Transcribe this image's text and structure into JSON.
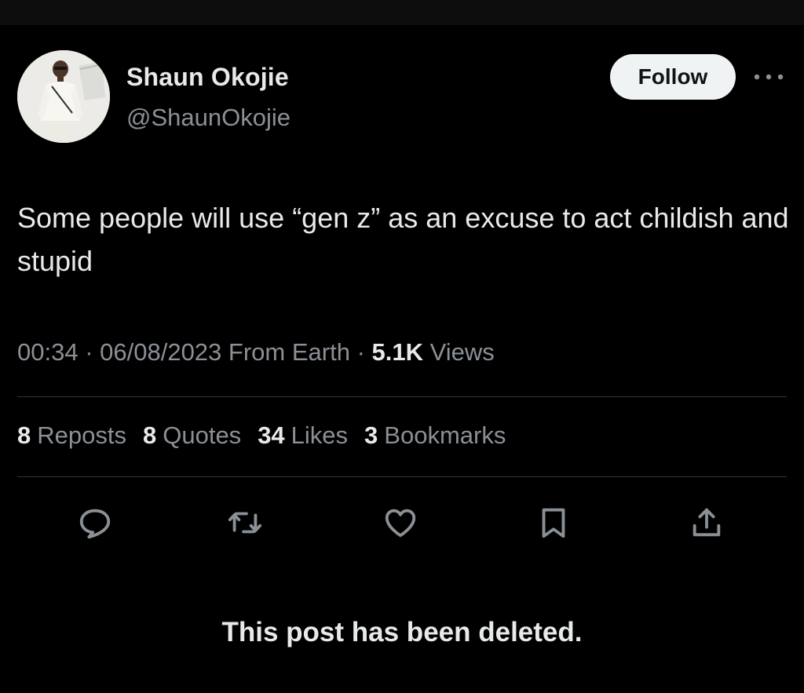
{
  "author": {
    "display_name": "Shaun Okojie",
    "handle": "@ShaunOkojie",
    "avatar": "profile-photo"
  },
  "follow_label": "Follow",
  "tweet": {
    "text": "Some people will use “gen z” as an excuse to act childish and stupid",
    "time": "00:34",
    "date": "06/08/2023",
    "source": "From Earth",
    "views_count": "5.1K",
    "views_label": "Views"
  },
  "stats": [
    {
      "count": "8",
      "label": "Reposts"
    },
    {
      "count": "8",
      "label": "Quotes"
    },
    {
      "count": "34",
      "label": "Likes"
    },
    {
      "count": "3",
      "label": "Bookmarks"
    }
  ],
  "actions": [
    "reply-icon",
    "repost-icon",
    "like-icon",
    "bookmark-icon",
    "share-icon"
  ],
  "deleted_message": "This post has been deleted.",
  "colors": {
    "background": "#000000",
    "primary_text": "#e7e9ea",
    "secondary_text": "#8b9096",
    "divider": "#2f3336",
    "follow_bg": "#eff3f4"
  }
}
